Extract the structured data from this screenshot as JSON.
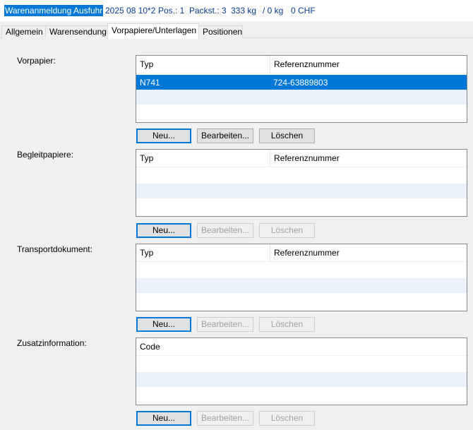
{
  "header": {
    "title": "Warenanmeldung Ausfuhr",
    "date": "2025 08 10*2",
    "pos": "Pos.: 1",
    "packst": "Packst.: 3",
    "weight": "333 kg",
    "weight2": "/ 0 kg",
    "amount": "0 CHF"
  },
  "tabs": [
    "Allgemein",
    "Warensendung",
    "Vorpapiere/Unterlagen",
    "Positionen"
  ],
  "active_tab": "Vorpapiere/Unterlagen",
  "sections": [
    {
      "label": "Vorpapier:",
      "columns": [
        "Typ",
        "Referenznummer"
      ],
      "rows": [
        [
          "N741",
          "724-63889803"
        ]
      ],
      "buttons": {
        "new": "Neu...",
        "edit": "Bearbeiten...",
        "delete": "Löschen"
      }
    },
    {
      "label": "Begleitpapiere:",
      "columns": [
        "Typ",
        "Referenznummer"
      ],
      "rows": [],
      "buttons": {
        "new": "Neu...",
        "edit": "Bearbeiten...",
        "delete": "Löschen"
      }
    },
    {
      "label": "Transportdokument:",
      "columns": [
        "Typ",
        "Referenznummer"
      ],
      "rows": [],
      "buttons": {
        "new": "Neu...",
        "edit": "Bearbeiten...",
        "delete": "Löschen"
      }
    },
    {
      "label": "Zusatzinformation:",
      "columns": [
        "Code"
      ],
      "rows": [],
      "buttons": {
        "new": "Neu...",
        "edit": "Bearbeiten...",
        "delete": "Löschen"
      }
    }
  ],
  "colors": {
    "selection": "#0078d7",
    "header_info": "#0a3d91",
    "alt_row": "#eaf1fb"
  }
}
